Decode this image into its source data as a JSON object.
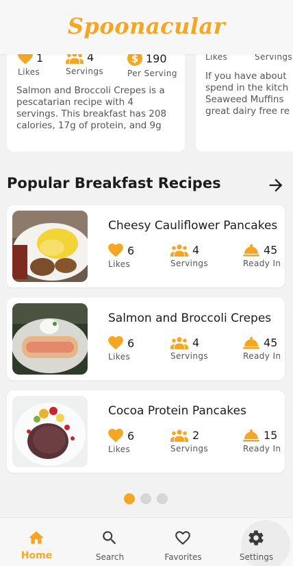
{
  "app": {
    "logo": "Spoonacular"
  },
  "colors": {
    "accent": "#f5a623",
    "text": "#1c1c1c",
    "muted": "#555555"
  },
  "top_carousel": {
    "card1": {
      "likes": {
        "value": "1",
        "label": "Likes",
        "icon": "heart-icon"
      },
      "servings": {
        "value": "4",
        "label": "Servings",
        "icon": "people-icon"
      },
      "price": {
        "value": "190",
        "label": "Per Serving",
        "icon": "dollar-icon"
      },
      "summary": "Salmon and Broccoli Crepes is a pescatarian recipe with 4 servings. This breakfast has 208 calories, 17g of protein, and 9g of…"
    },
    "card2": {
      "likes_label": "Likes",
      "servings_label": "Servings",
      "summary_lines": [
        "If you have about",
        "spend in the kitch",
        "Seaweed Muffins",
        "great dairy free re"
      ]
    }
  },
  "section": {
    "title": "Popular Breakfast Recipes",
    "arrow_icon": "arrow-right-icon"
  },
  "recipes": [
    {
      "title": "Cheesy Cauliflower Pancakes",
      "likes": "6",
      "likes_label": "Likes",
      "servings": "4",
      "servings_label": "Servings",
      "ready": "45",
      "ready_label": "Ready In"
    },
    {
      "title": "Salmon and Broccoli Crepes",
      "likes": "6",
      "likes_label": "Likes",
      "servings": "4",
      "servings_label": "Servings",
      "ready": "45",
      "ready_label": "Ready In"
    },
    {
      "title": "Cocoa Protein Pancakes",
      "likes": "6",
      "likes_label": "Likes",
      "servings": "2",
      "servings_label": "Servings",
      "ready": "15",
      "ready_label": "Ready In"
    }
  ],
  "pager": {
    "active_index": 0,
    "count": 3
  },
  "bottom_nav": [
    {
      "label": "Home",
      "icon": "home-icon",
      "active": true
    },
    {
      "label": "Search",
      "icon": "search-icon",
      "active": false
    },
    {
      "label": "Favorites",
      "icon": "heart-outline-icon",
      "active": false
    },
    {
      "label": "Settings",
      "icon": "gear-icon",
      "active": false
    }
  ]
}
